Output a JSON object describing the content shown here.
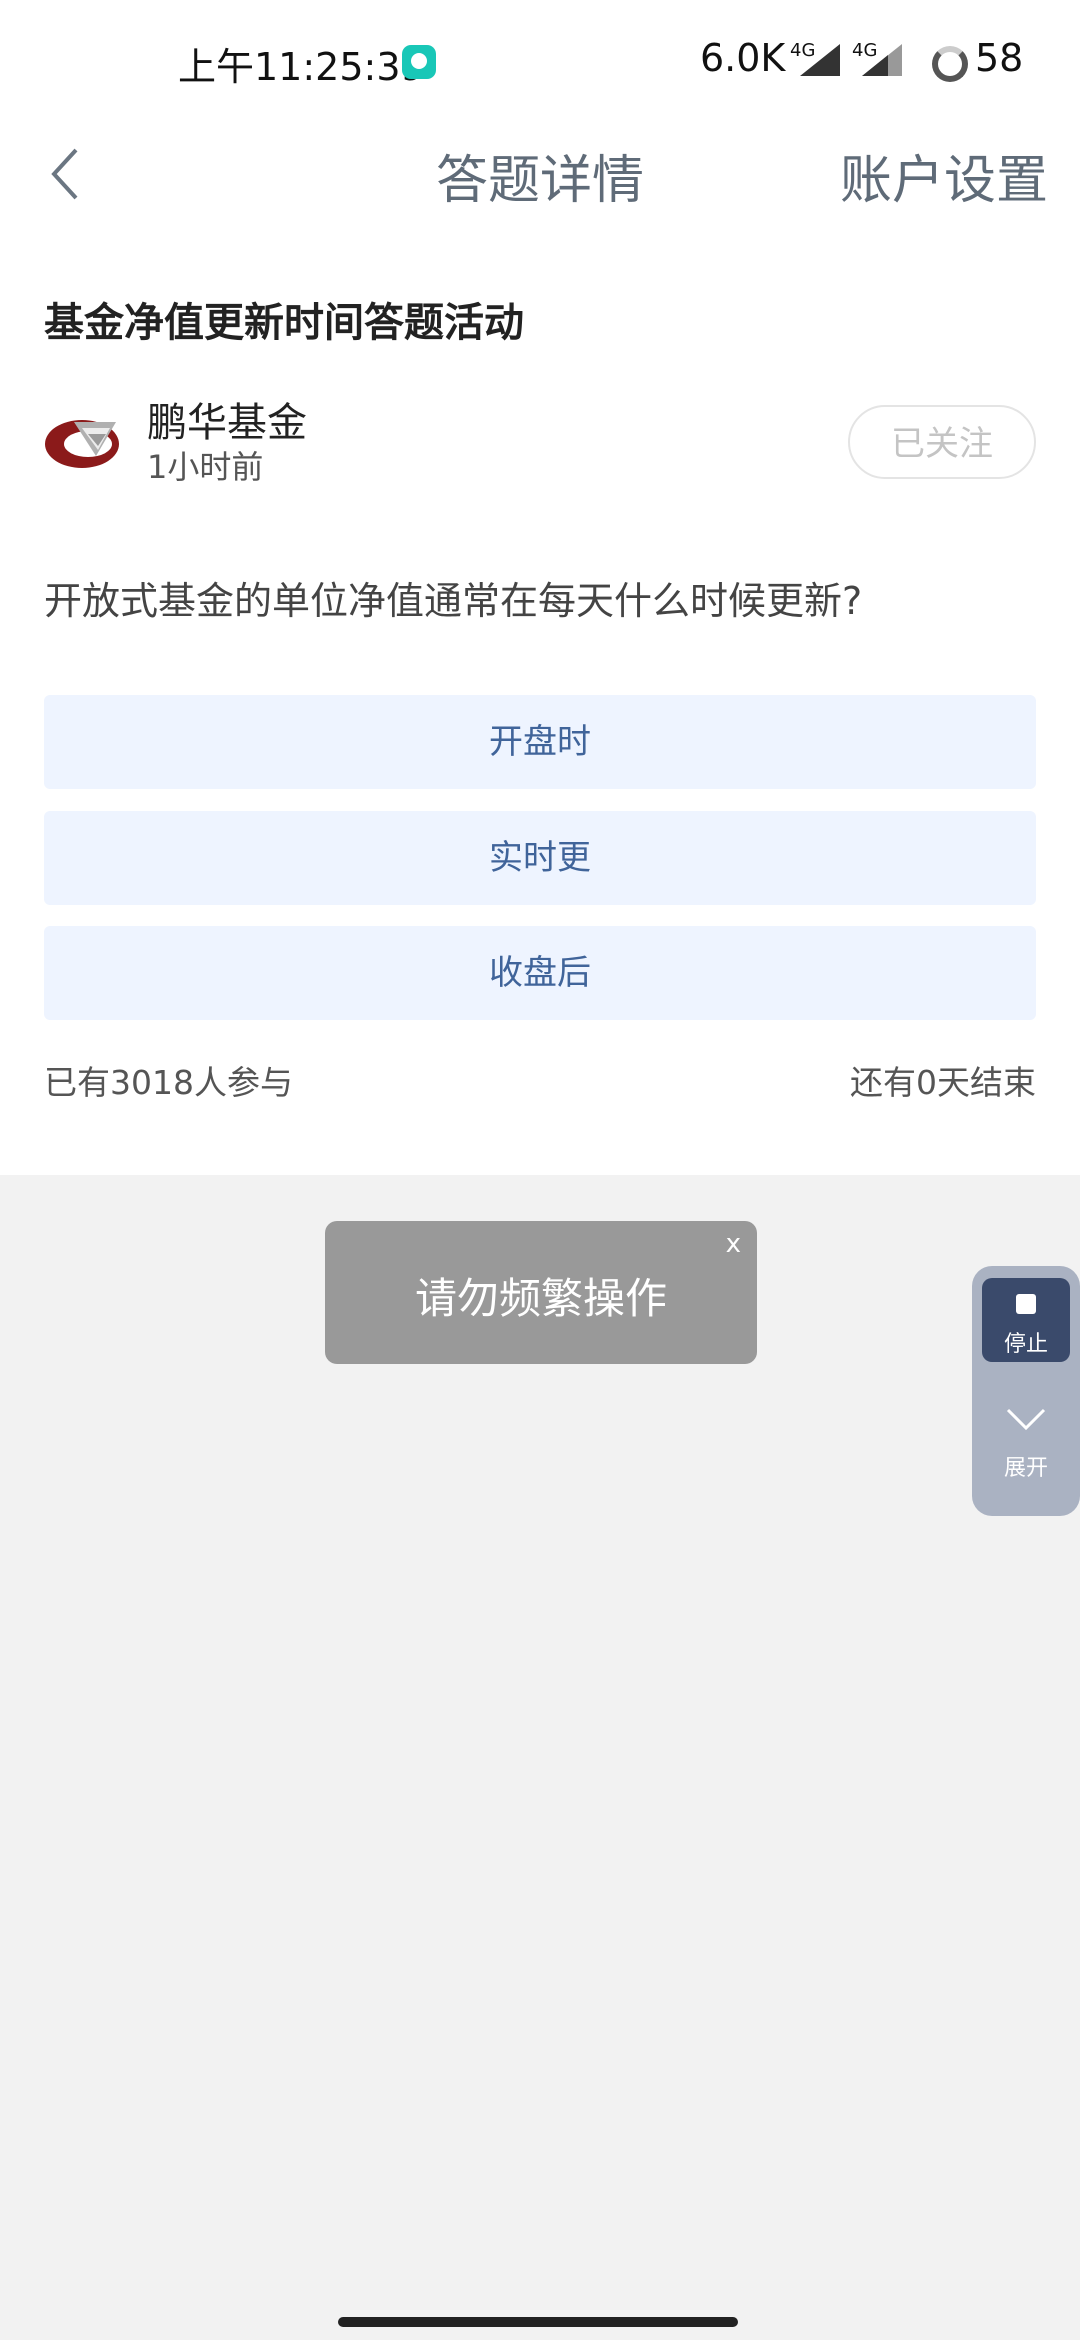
{
  "status_bar": {
    "time": "上午11:25:39",
    "speed": "6.0K",
    "net1": "4G",
    "net2": "4G",
    "battery": "58"
  },
  "header": {
    "title": "答题详情",
    "account_settings": "账户设置",
    "back_icon": "chevron-left-icon"
  },
  "activity": {
    "title": "基金净值更新时间答题活动",
    "publisher": "鹏华基金",
    "published_ago": "1小时前",
    "follow_label": "已关注",
    "question": "开放式基金的单位净值通常在每天什么时候更新?",
    "options": [
      {
        "label": "开盘时"
      },
      {
        "label": "实时更"
      },
      {
        "label": "收盘后"
      }
    ],
    "participants": "已有3018人参与",
    "remaining": "还有0天结束"
  },
  "toast": {
    "message": "请勿频繁操作",
    "close": "x"
  },
  "floating_widget": {
    "stop_label": "停止",
    "expand_label": "展开"
  },
  "colors": {
    "option_bg": "#eef4ff",
    "option_text": "#40649a",
    "toast_bg": "#999999",
    "widget_bg": "#aab2c2",
    "stop_bg": "#3a4a6b"
  }
}
